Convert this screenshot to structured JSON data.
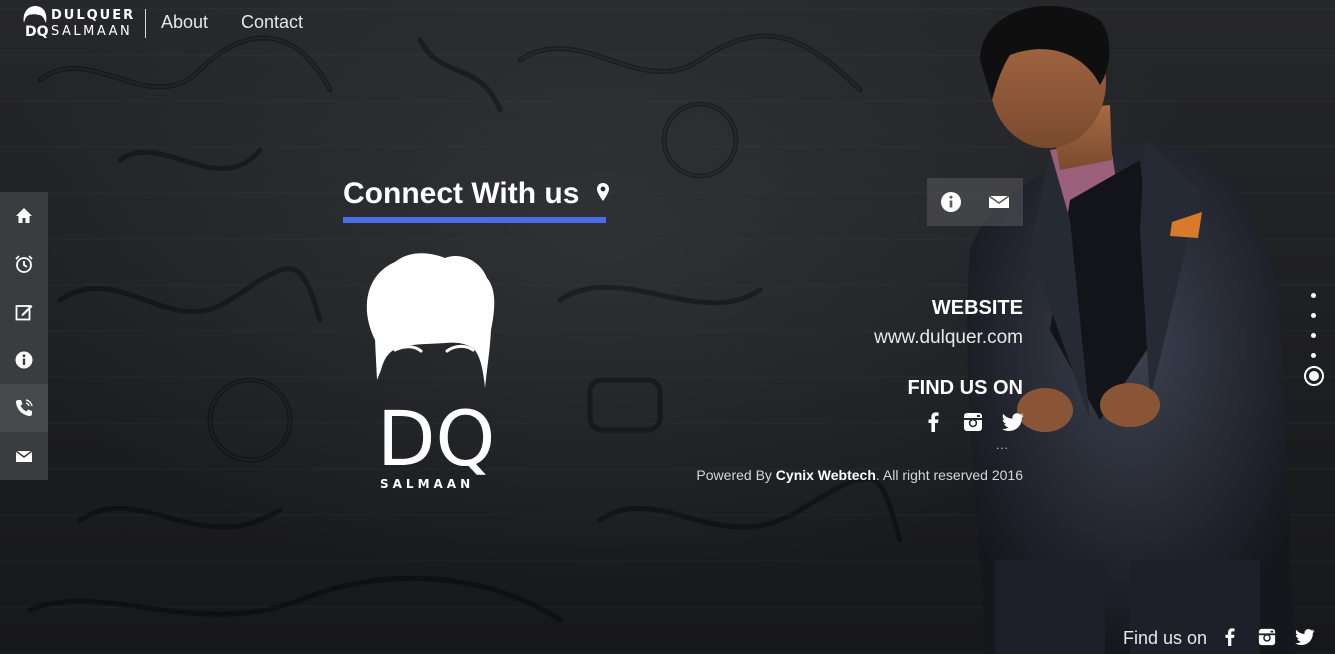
{
  "brand": {
    "dq": "DQ",
    "line1": "DULQUER",
    "line2": "SALMAAN"
  },
  "nav": {
    "about": "About",
    "contact": "Contact"
  },
  "sidebar": {
    "items": [
      {
        "icon": "home-icon"
      },
      {
        "icon": "alarm-clock-icon"
      },
      {
        "icon": "edit-icon"
      },
      {
        "icon": "info-icon"
      },
      {
        "icon": "phone-icon"
      },
      {
        "icon": "mail-icon"
      }
    ]
  },
  "heading": {
    "title": "Connect With us",
    "icon": "location-pin-icon",
    "underline_color": "#4a6ce6"
  },
  "logo": {
    "letters": "DQ",
    "subtitle": "SALMAAN"
  },
  "info_box": {
    "tabs": [
      {
        "icon": "info-icon"
      },
      {
        "icon": "mail-icon"
      }
    ]
  },
  "contact": {
    "website_label": "WEBSITE",
    "website_url": "www.dulquer.com",
    "find_label": "FIND US ON",
    "socials": [
      "facebook-icon",
      "instagram-icon",
      "twitter-icon"
    ],
    "more": "...",
    "powered_prefix": "Powered By",
    "powered_company": "Cynix Webtech",
    "powered_suffix": ". All right reserved 2016"
  },
  "pager": {
    "count": 5,
    "active_index": 4
  },
  "footer": {
    "find_us": "Find us on",
    "socials": [
      "facebook-icon",
      "instagram-icon",
      "twitter-icon"
    ]
  }
}
